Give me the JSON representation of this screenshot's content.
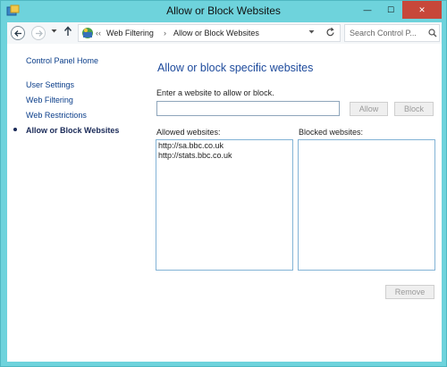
{
  "window": {
    "title": "Allow or Block Websites",
    "controls": {
      "minimize": "—",
      "maximize": "☐",
      "close": "✕"
    }
  },
  "address": {
    "crumb_sep": "‹‹",
    "crumbs": [
      "Web Filtering",
      "Allow or Block Websites"
    ],
    "separator": "›",
    "search_placeholder": "Search Control P..."
  },
  "sidebar": {
    "home": "Control Panel Home",
    "items": [
      {
        "label": "User Settings",
        "active": false
      },
      {
        "label": "Web Filtering",
        "active": false
      },
      {
        "label": "Web Restrictions",
        "active": false
      },
      {
        "label": "Allow or Block Websites",
        "active": true
      }
    ]
  },
  "main": {
    "heading": "Allow or block specific websites",
    "instruction": "Enter a website to allow or block.",
    "url_value": "",
    "allow_label": "Allow",
    "block_label": "Block",
    "allowed_label": "Allowed websites:",
    "blocked_label": "Blocked websites:",
    "allowed_sites": [
      "http://sa.bbc.co.uk",
      "http://stats.bbc.co.uk"
    ],
    "blocked_sites": [],
    "remove_label": "Remove"
  },
  "colors": {
    "frame": "#6ed3dc",
    "link": "#0b3e8a",
    "heading": "#1d4a9c",
    "close_button": "#c7473a"
  },
  "icons": [
    "app-icon",
    "back-icon",
    "forward-icon",
    "recent-pages-icon",
    "up-icon",
    "control-panel-icon",
    "dropdown-icon",
    "refresh-icon",
    "search-icon"
  ]
}
